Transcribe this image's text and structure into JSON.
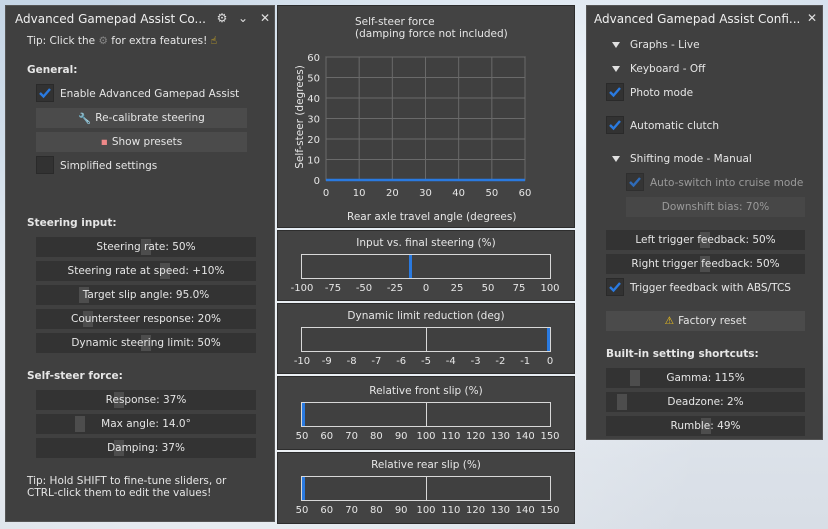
{
  "left_panel": {
    "title": "Advanced Gamepad Assist Co...",
    "tip_top": [
      "Tip: Click the",
      "for extra features!"
    ],
    "general_header": "General:",
    "enable_label": "Enable Advanced Gamepad Assist",
    "recalibrate_label": "Re-calibrate steering",
    "presets_label": "Show presets",
    "simplified_label": "Simplified settings",
    "steering_header": "Steering input:",
    "steering_sliders": [
      {
        "label": "Steering rate: 50%",
        "value": 0.5
      },
      {
        "label": "Steering rate at speed: +10%",
        "value": 0.59
      },
      {
        "label": "Target slip angle: 95.0%",
        "value": 0.2
      },
      {
        "label": "Countersteer response: 20%",
        "value": 0.22
      },
      {
        "label": "Dynamic steering limit: 50%",
        "value": 0.5
      }
    ],
    "selfsteer_header": "Self-steer force:",
    "selfsteer_sliders": [
      {
        "label": "Response: 37%",
        "value": 0.37
      },
      {
        "label": "Max angle: 14.0°",
        "value": 0.18
      },
      {
        "label": "Damping: 37%",
        "value": 0.37
      }
    ],
    "tip_bottom_1": "Tip: Hold SHIFT to fine-tune sliders, or",
    "tip_bottom_2": "CTRL-click them to edit the values!"
  },
  "graphs": {
    "selfsteer": {
      "title_1": "Self-steer force",
      "title_2": "(damping force not included)",
      "ylabel": "Self-steer (degrees)",
      "xlabel": "Rear axle travel angle (degrees)",
      "y_ticks": [
        "60",
        "50",
        "40",
        "30",
        "20",
        "10",
        "0"
      ],
      "x_ticks": [
        "0",
        "10",
        "20",
        "30",
        "40",
        "50",
        "60"
      ]
    },
    "input_final": {
      "title": "Input vs. final steering (%)",
      "ticks": [
        "-100",
        "-75",
        "-50",
        "-25",
        "0",
        "25",
        "50",
        "75",
        "100"
      ]
    },
    "dyn_limit": {
      "title": "Dynamic limit reduction (deg)",
      "ticks": [
        "-10",
        "-9",
        "-8",
        "-7",
        "-6",
        "-5",
        "-4",
        "-3",
        "-2",
        "-1",
        "0"
      ]
    },
    "front_slip": {
      "title": "Relative front slip (%)",
      "ticks": [
        "50",
        "60",
        "70",
        "80",
        "90",
        "100",
        "110",
        "120",
        "130",
        "140",
        "150"
      ]
    },
    "rear_slip": {
      "title": "Relative rear slip (%)",
      "ticks": [
        "50",
        "60",
        "70",
        "80",
        "90",
        "100",
        "110",
        "120",
        "130",
        "140",
        "150"
      ]
    }
  },
  "chart_data": [
    {
      "type": "line",
      "title": "Self-steer force",
      "subtitle": "(damping force not included)",
      "xlabel": "Rear axle travel angle (degrees)",
      "ylabel": "Self-steer (degrees)",
      "xlim": [
        0,
        60
      ],
      "ylim": [
        0,
        60
      ],
      "grid": true,
      "x": [
        0,
        60
      ],
      "y": [
        0,
        0
      ],
      "color": "#2a7ae0"
    },
    {
      "type": "bar",
      "title": "Input vs. final steering (%)",
      "xlim": [
        -100,
        100
      ],
      "markers": [
        -13
      ]
    },
    {
      "type": "bar",
      "title": "Dynamic limit reduction (deg)",
      "xlim": [
        -10,
        0
      ],
      "markers": [
        0
      ]
    },
    {
      "type": "bar",
      "title": "Relative front slip (%)",
      "xlim": [
        50,
        150
      ],
      "markers": [
        50
      ]
    },
    {
      "type": "bar",
      "title": "Relative rear slip (%)",
      "xlim": [
        50,
        150
      ],
      "markers": [
        50
      ]
    }
  ],
  "right_panel": {
    "title": "Advanced Gamepad Assist Confi...",
    "graphs_label": "Graphs - Live",
    "keyboard_label": "Keyboard - Off",
    "photo_label": "Photo mode",
    "clutch_label": "Automatic clutch",
    "shifting_label": "Shifting mode - Manual",
    "cruise_label": "Auto-switch into cruise mode",
    "downshift_label": "Downshift bias: 70%",
    "left_trigger_label": "Left trigger feedback: 50%",
    "right_trigger_label": "Right trigger feedback: 50%",
    "trigger_abs_label": "Trigger feedback with ABS/TCS",
    "factory_reset_label": "Factory reset",
    "shortcuts_header": "Built-in setting shortcuts:",
    "shortcuts": [
      {
        "label": "Gamma:    115%",
        "value": 0.12
      },
      {
        "label": "Deadzone: 2%",
        "value": 0.05
      },
      {
        "label": "Rumble: 49%",
        "value": 0.5
      }
    ]
  },
  "colors": {
    "accent_blue": "#2a7ae0",
    "panel_bg": "#404040",
    "warning_yellow": "#f2c31b"
  }
}
